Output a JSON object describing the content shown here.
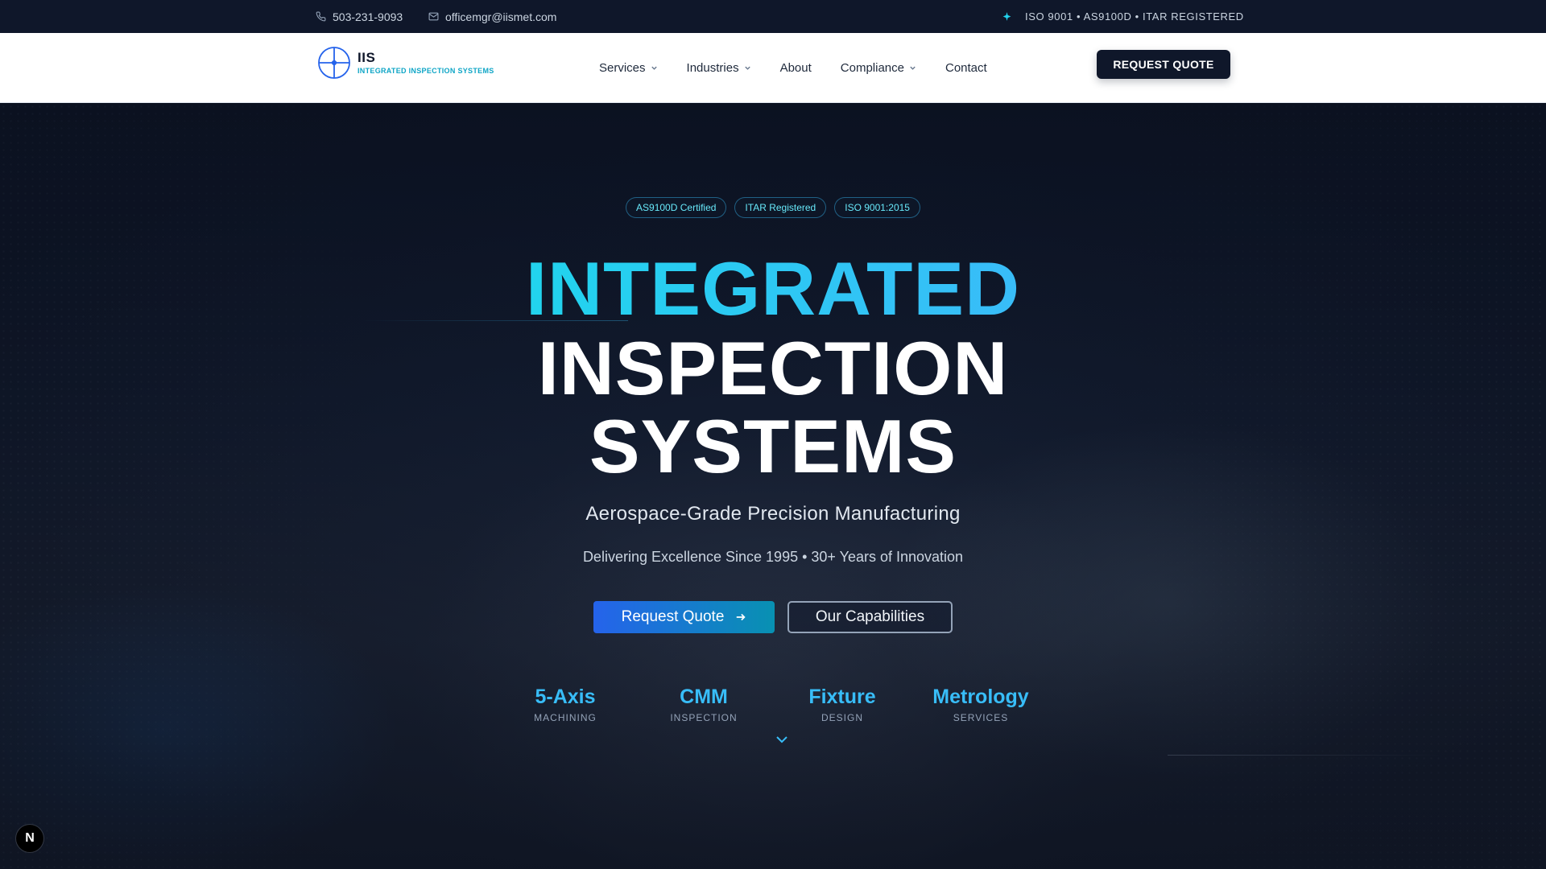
{
  "topbar": {
    "phone": "503-231-9093",
    "email": "officemgr@iismet.com",
    "certifications": "ISO 9001 • AS9100D • ITAR REGISTERED"
  },
  "nav": {
    "logo_title": "IIS",
    "logo_subtitle": "INTEGRATED INSPECTION SYSTEMS",
    "items": [
      {
        "label": "Services"
      },
      {
        "label": "Industries"
      },
      {
        "label": "About"
      },
      {
        "label": "Compliance"
      },
      {
        "label": "Contact"
      }
    ],
    "cta": "REQUEST QUOTE"
  },
  "hero": {
    "badges": [
      "AS9100D Certified",
      "ITAR Registered",
      "ISO 9001:2015"
    ],
    "title_line1": "INTEGRATED",
    "title_line2": "INSPECTION",
    "title_line3": "SYSTEMS",
    "subtitle": "Aerospace-Grade Precision Manufacturing",
    "tagline": "Delivering Excellence Since 1995 • 30+ Years of Innovation",
    "primary_button": "Request Quote",
    "secondary_button": "Our Capabilities",
    "stats": [
      {
        "value": "5-Axis",
        "label": "MACHINING"
      },
      {
        "value": "CMM",
        "label": "INSPECTION"
      },
      {
        "value": "Fixture",
        "label": "DESIGN"
      },
      {
        "value": "Metrology",
        "label": "SERVICES"
      }
    ]
  },
  "dev_badge": "N",
  "colors": {
    "accent": "#38bdf8",
    "navy": "#0f172a",
    "primary_gradient_start": "#2563eb",
    "primary_gradient_end": "#0891b2"
  }
}
